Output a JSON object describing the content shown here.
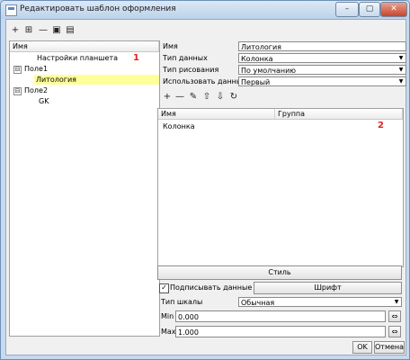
{
  "window": {
    "title": "Редактировать шаблон оформления",
    "minimize": "–",
    "maximize": "▢",
    "close": "✕"
  },
  "toolbar": {
    "add": "+",
    "add_child": "⊞",
    "remove": "—",
    "save": "▣",
    "open": "▤"
  },
  "tree": {
    "header": "Имя",
    "items": [
      {
        "label": "Настройки планшета"
      },
      {
        "label": "Поле1",
        "expander": "⊟"
      },
      {
        "label": "Литология"
      },
      {
        "label": "Поле2",
        "expander": "⊟"
      },
      {
        "label": "GK"
      }
    ],
    "marker": "1"
  },
  "props": {
    "name_label": "Имя",
    "name_value": "Литология",
    "datatype_label": "Тип данных",
    "datatype_value": "Колонка",
    "drawtype_label": "Тип рисования",
    "drawtype_value": "По умолчанию",
    "usedata_label": "Использовать данные",
    "usedata_value": "Первый"
  },
  "columns_toolbar": {
    "add": "+",
    "remove": "—",
    "edit": "✎",
    "up": "⇧",
    "down": "⇩",
    "refresh": "↻"
  },
  "columns_grid": {
    "headers": [
      "Имя",
      "Группа"
    ],
    "rows": [
      {
        "name": "Колонка",
        "group": ""
      }
    ],
    "marker": "2"
  },
  "style_button": "Стиль",
  "sign_data": {
    "label": "Подписывать данные",
    "checked": true,
    "check_mark": "✓"
  },
  "font_button": "Шрифт",
  "scale": {
    "label": "Тип шкалы",
    "value": "Обычная"
  },
  "min": {
    "label": "Min",
    "value": "0.000"
  },
  "max": {
    "label": "Max",
    "value": "1.000"
  },
  "footer": {
    "ok": "OK",
    "cancel": "Отмена"
  }
}
